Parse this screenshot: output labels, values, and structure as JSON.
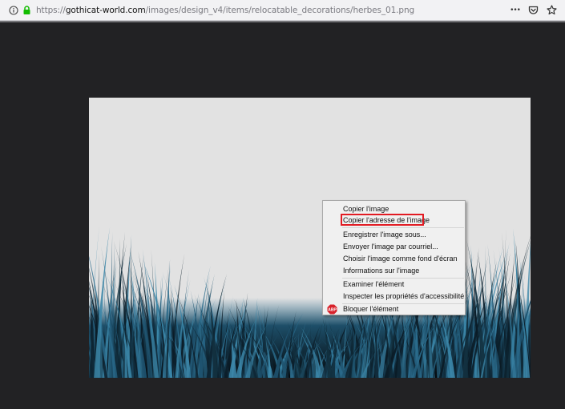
{
  "browser": {
    "url_prefix": "https://",
    "url_domain": "gothicat-world.com",
    "url_path": "/images/design_v4/items/relocatable_decorations/herbes_01.png",
    "more_label": "•••",
    "icons": [
      "info-icon",
      "lock-icon",
      "pocket-icon",
      "bookmark-star-icon"
    ]
  },
  "context_menu": {
    "items": [
      {
        "label": "Copier l'image"
      },
      {
        "label": "Copier l'adresse de l'image"
      },
      {
        "label": "Enregistrer l'image sous..."
      },
      {
        "label": "Envoyer l'image par courriel..."
      },
      {
        "label": "Choisir l'image comme fond d'écran"
      },
      {
        "label": "Informations sur l'image"
      },
      {
        "label": "Examiner l'élément"
      },
      {
        "label": "Inspecter les propriétés d'accessibilité"
      },
      {
        "label": "Bloquer l'élément"
      }
    ],
    "abp_badge": "ABP"
  },
  "colors": {
    "page_bg": "#222224",
    "image_bg": "#e2e2e2",
    "grass_dark": "#0b1c27",
    "grass_blue": "#2a6b8c",
    "highlight": "#e21b23",
    "lock_green": "#12bc00"
  }
}
